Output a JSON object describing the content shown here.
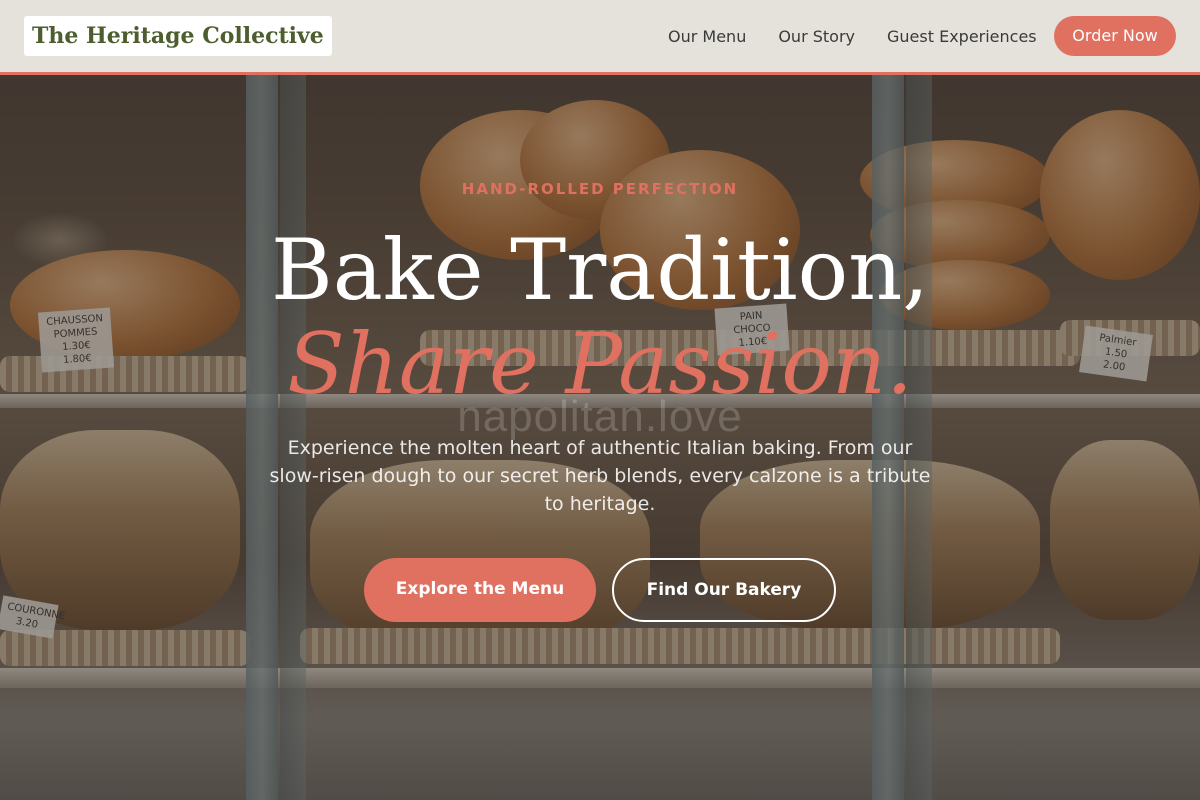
{
  "navbar": {
    "logo": "The Heritage Collective",
    "links": [
      "Our Menu",
      "Our Story",
      "Guest Experiences"
    ],
    "cta": "Order Now"
  },
  "hero": {
    "eyebrow": "HAND-ROLLED PERFECTION",
    "title_line1": "Bake Tradition,",
    "title_line2": "Share Passion.",
    "subtitle": "Experience the molten heart of authentic Italian baking. From our slow-risen dough to our secret herb blends, every calzone is a tribute to heritage.",
    "primary_button": "Explore the Menu",
    "secondary_button": "Find Our Bakery",
    "watermark": "napolitan.love"
  },
  "price_tags": {
    "chausson": "CHAUSSON\nPOMMES\n1.30€\n1.80€",
    "pain_choco": "PAIN CHOCO\n1.10€",
    "palmier": "Palmier\n1.50\n2.00",
    "couronne": "COURONNE\n3.20"
  },
  "colors": {
    "accent": "#e07060",
    "logo_green": "#4c5d2e",
    "nav_background": "#f3f1ec"
  }
}
